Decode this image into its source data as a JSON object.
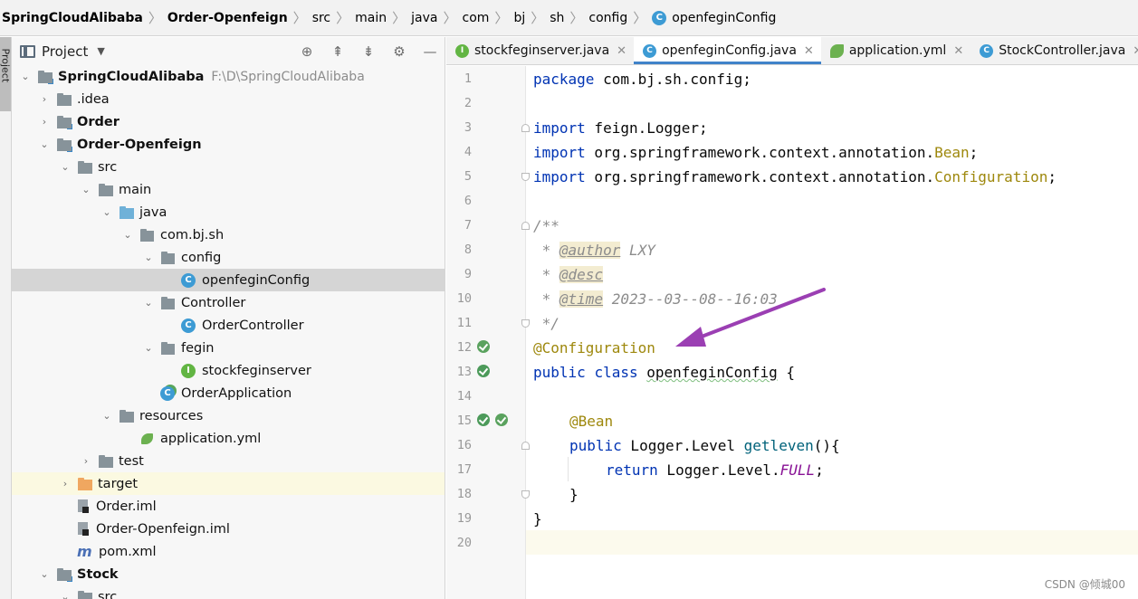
{
  "breadcrumb": {
    "items": [
      "SpringCloudAlibaba",
      "Order-Openfeign",
      "src",
      "main",
      "java",
      "com",
      "bj",
      "sh",
      "config",
      "openfeginConfig"
    ],
    "icon_last": "class-icon"
  },
  "side_stripe": {
    "label": "Project"
  },
  "project_panel": {
    "title": "Project",
    "tools": [
      "locate-icon",
      "expand-all-icon",
      "collapse-all-icon",
      "gear-icon",
      "minimize-icon"
    ]
  },
  "tree": [
    {
      "label": "SpringCloudAlibaba",
      "path": "F:\\D\\SpringCloudAlibaba",
      "bold": true
    },
    {
      "label": ".idea"
    },
    {
      "label": "Order",
      "bold": true
    },
    {
      "label": "Order-Openfeign",
      "bold": true
    },
    {
      "label": "src"
    },
    {
      "label": "main"
    },
    {
      "label": "java"
    },
    {
      "label": "com.bj.sh"
    },
    {
      "label": "config"
    },
    {
      "label": "openfeginConfig"
    },
    {
      "label": "Controller"
    },
    {
      "label": "OrderController"
    },
    {
      "label": "fegin"
    },
    {
      "label": "stockfeginserver"
    },
    {
      "label": "OrderApplication"
    },
    {
      "label": "resources"
    },
    {
      "label": "application.yml"
    },
    {
      "label": "test"
    },
    {
      "label": "target"
    },
    {
      "label": "Order.iml"
    },
    {
      "label": "Order-Openfeign.iml"
    },
    {
      "label": "pom.xml"
    },
    {
      "label": "Stock",
      "bold": true
    },
    {
      "label": "src"
    }
  ],
  "tabs": [
    {
      "label": "stockfeginserver.java",
      "icon": "interface-icon"
    },
    {
      "label": "openfeginConfig.java",
      "icon": "class-icon",
      "active": true
    },
    {
      "label": "application.yml",
      "icon": "spring-yml-icon"
    },
    {
      "label": "StockController.java",
      "icon": "class-icon"
    }
  ],
  "editor": {
    "line_numbers": [
      "1",
      "2",
      "3",
      "4",
      "5",
      "6",
      "7",
      "8",
      "9",
      "10",
      "11",
      "12",
      "13",
      "14",
      "15",
      "16",
      "17",
      "18",
      "19",
      "20"
    ],
    "code": {
      "l1_kw": "package",
      "l1_rest": " com.bj.sh.config;",
      "l3_kw": "import",
      "l3_rest": " feign.Logger;",
      "l4_kw": "import",
      "l4_rest": " org.springframework.context.annotation.",
      "l4_ann": "Bean",
      "l4_end": ";",
      "l5_kw": "import",
      "l5_rest": " org.springframework.context.annotation.",
      "l5_ann": "Configuration",
      "l5_end": ";",
      "l7": "/**",
      "l8_pre": " * ",
      "l8_tag": "@author",
      "l8_val": " LXY",
      "l9_pre": " * ",
      "l9_tag": "@desc",
      "l10_pre": " * ",
      "l10_tag": "@time",
      "l10_val": " 2023--03--08--16:03",
      "l11": " */",
      "l12": "@Configuration",
      "l13_kw1": "public",
      "l13_kw2": "class",
      "l13_name": "openfeginConfig",
      "l13_end": " {",
      "l15": "@Bean",
      "l16_kw": "public",
      "l16_type": " Logger.Level ",
      "l16_fn": "getleven",
      "l16_end": "(){",
      "l17_kw": "return",
      "l17_type": " Logger.Level.",
      "l17_field": "FULL",
      "l17_end": ";",
      "l18": "}",
      "l19": "}"
    },
    "arrow_color": "#9b3fb3"
  },
  "watermark": "CSDN @倾城00"
}
